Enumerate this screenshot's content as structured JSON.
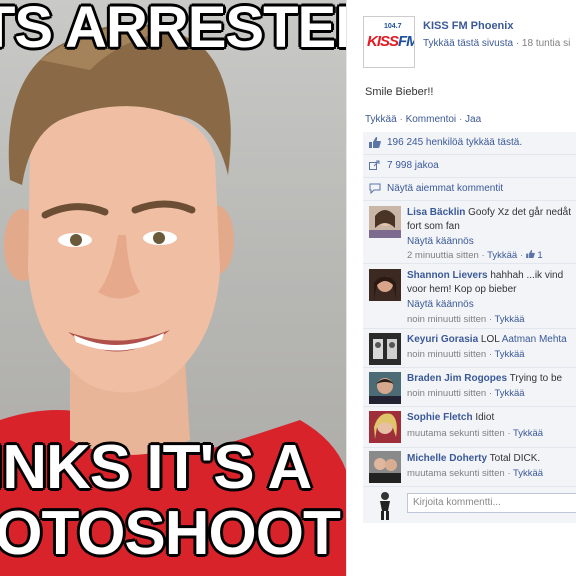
{
  "meme": {
    "top_text": "TS ARRESTED",
    "bottom_line1": "INKS IT'S A",
    "bottom_line2": "IOTOSHOOT"
  },
  "colors": {
    "fb_blue": "#3b5998",
    "meta_gray": "#7f7f7f",
    "ufi_bg": "#f2f4f8"
  },
  "post": {
    "page_name": "KISS FM Phoenix",
    "logo": {
      "freq": "104.7",
      "brand_a": "KISS",
      "brand_b": "FM"
    },
    "like_page": "Tykkää tästä sivusta",
    "time": " · 18 tuntia si",
    "text": "Smile Bieber!!",
    "actions": {
      "like": "Tykkää",
      "comment": "Kommentoi",
      "share": "Jaa"
    }
  },
  "ufi": {
    "likes": "196 245 henkilöä tykkää tästä.",
    "shares": "7 998 jakoa",
    "view_previous": "Näytä aiemmat kommentit",
    "comment_placeholder": "Kirjoita kommentti..."
  },
  "comments": [
    {
      "name": "Lisa Bäcklin",
      "line1": " Goofy Xz det går nedåt",
      "line2": "fort som fan",
      "translate": "Näytä käännös",
      "time": "2 minuuttia sitten",
      "like": "Tykkää",
      "likes": "1"
    },
    {
      "name": "Shannon Lievers",
      "line1": " hahhah ...ik vind",
      "line2": "voor hem! Kop op bieber",
      "translate": "Näytä käännös",
      "time": "noin minuutti sitten",
      "like": "Tykkää"
    },
    {
      "name": "Keyuri Gorasia",
      "line1": " LOL ",
      "mention": "Aatman Mehta",
      "time": "noin minuutti sitten",
      "like": "Tykkää"
    },
    {
      "name": "Braden Jim Rogopes",
      "line1": " Trying to be",
      "time": "noin minuutti sitten",
      "like": "Tykkää"
    },
    {
      "name": "Sophie Fletch",
      "line1": " Idiot",
      "time": "muutama sekunti sitten",
      "like": "Tykkää"
    },
    {
      "name": "Michelle Doherty",
      "line1": " Total DICK.",
      "time": "muutama sekunti sitten",
      "like": "Tykkää"
    }
  ]
}
